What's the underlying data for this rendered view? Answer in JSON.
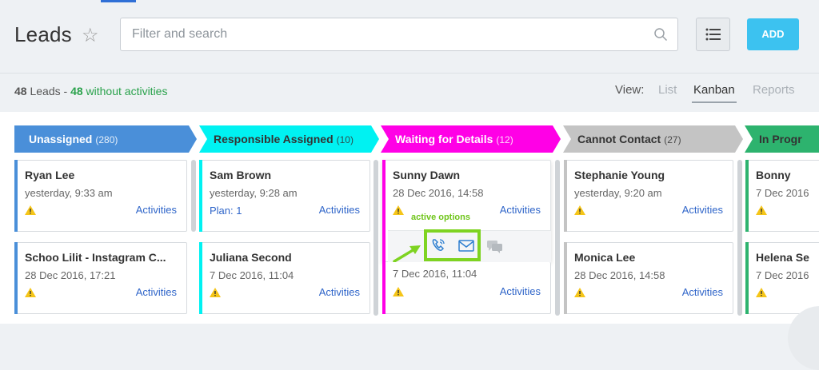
{
  "header": {
    "title": "Leads",
    "search_placeholder": "Filter and search",
    "add_label": "ADD"
  },
  "stats": {
    "total": "48",
    "leads_label": "Leads -",
    "without": "48",
    "without_label": "without activities"
  },
  "view": {
    "label": "View:",
    "options": [
      "List",
      "Kanban",
      "Reports"
    ],
    "active": "Kanban"
  },
  "columns": [
    {
      "title": "Unassigned",
      "count": "(280)",
      "color": "#4a8fd9"
    },
    {
      "title": "Responsible Assigned",
      "count": "(10)",
      "color": "#00f2f2"
    },
    {
      "title": "Waiting for Details",
      "count": "(12)",
      "color": "#ff00e6"
    },
    {
      "title": "Cannot Contact",
      "count": "(27)",
      "color": "#c4c4c4"
    },
    {
      "title": "In Progr",
      "count": "",
      "color": "#2db36e"
    }
  ],
  "cards": [
    {
      "name": "Ryan Lee",
      "date": "yesterday, 9:33 am",
      "activities": "Activities"
    },
    {
      "name": "Schoo Lilit - Instagram C...",
      "date": "28 Dec 2016, 17:21",
      "activities": "Activities"
    },
    {
      "name": "Sam Brown",
      "date": "yesterday, 9:28 am",
      "plan": "Plan: 1",
      "activities": "Activities"
    },
    {
      "name": "Juliana Second",
      "date": "7 Dec 2016, 11:04",
      "activities": "Activities"
    },
    {
      "name": "Sunny Dawn",
      "date": "28 Dec 2016, 14:58",
      "activities": "Activities"
    },
    {
      "date": "7 Dec 2016, 11:04",
      "activities": "Activities"
    },
    {
      "name": "Stephanie Young",
      "date": "yesterday, 9:20 am",
      "activities": "Activities"
    },
    {
      "name": "Monica Lee",
      "date": "28 Dec 2016, 14:58",
      "activities": "Activities"
    },
    {
      "name": "Bonny",
      "date": "7 Dec 2016"
    },
    {
      "name": "Helena Se",
      "date": "7 Dec 2016"
    }
  ],
  "annotation": {
    "label": "active options"
  },
  "icons": [
    "star-icon",
    "search-icon",
    "list-view-icon",
    "warning-icon",
    "phone-icon",
    "mail-icon",
    "chat-icon",
    "arrow-icon"
  ]
}
